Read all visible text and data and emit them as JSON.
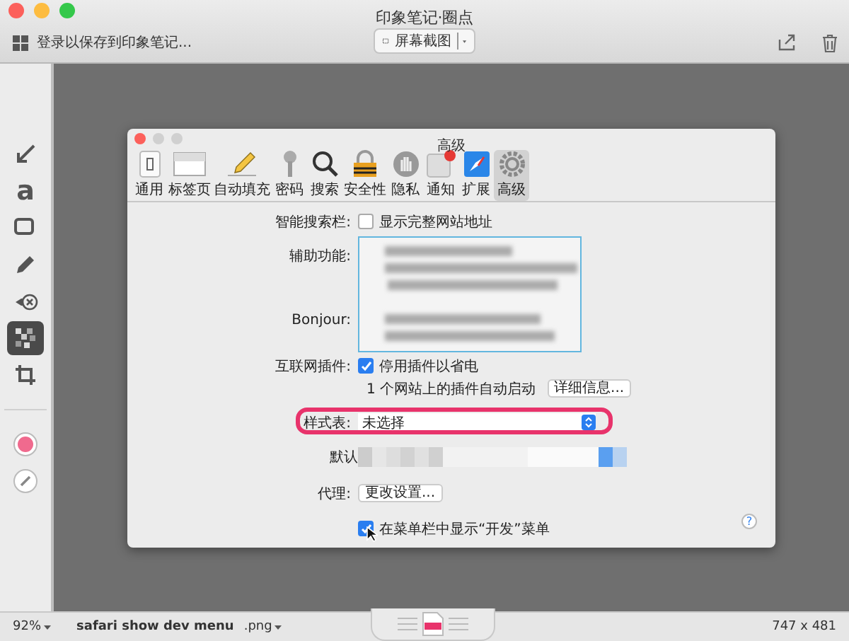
{
  "window": {
    "title": "印象笔记·圈点"
  },
  "toolbar": {
    "login": "登录以保存到印象笔记...",
    "capture_button": "屏幕截图"
  },
  "tools": [
    {
      "kind": "arrow",
      "selected": false
    },
    {
      "kind": "text",
      "label": "a",
      "selected": false
    },
    {
      "kind": "rectangle",
      "selected": false
    },
    {
      "kind": "pen",
      "selected": false
    },
    {
      "kind": "stamp",
      "selected": false
    },
    {
      "kind": "pixelate",
      "selected": true
    },
    {
      "kind": "crop",
      "selected": false
    }
  ],
  "color_swatch": {
    "color": "#f06a8e"
  },
  "canvas": {
    "prefs_window": {
      "title": "高级",
      "tabs": [
        {
          "kind": "general",
          "label": "通用",
          "selected": false
        },
        {
          "kind": "tabs",
          "label": "标签页",
          "selected": false
        },
        {
          "kind": "autofill",
          "label": "自动填充",
          "selected": false
        },
        {
          "kind": "passwords",
          "label": "密码",
          "selected": false
        },
        {
          "kind": "search",
          "label": "搜索",
          "selected": false
        },
        {
          "kind": "security",
          "label": "安全性",
          "selected": false
        },
        {
          "kind": "privacy",
          "label": "隐私",
          "selected": false
        },
        {
          "kind": "notifications",
          "label": "通知",
          "selected": false
        },
        {
          "kind": "extensions",
          "label": "扩展",
          "selected": false
        },
        {
          "kind": "advanced",
          "label": "高级",
          "selected": true
        }
      ],
      "smart_search": {
        "label": "智能搜索栏:",
        "checkbox": "显示完整网站地址",
        "checked": false
      },
      "accessibility": {
        "label": "辅助功能:",
        "bonjour_label": "Bonjour:"
      },
      "plugins": {
        "label": "互联网插件:",
        "checkbox": "停用插件以省电",
        "checked": true,
        "note": "1 个网站上的插件自动启动",
        "button": "详细信息..."
      },
      "stylesheet": {
        "label": "样式表:",
        "value": "未选择",
        "highlighted": true
      },
      "default_label": "默认",
      "proxy": {
        "label": "代理:",
        "button": "更改设置..."
      },
      "develop_menu": {
        "checkbox": "在菜单栏中显示“开发”菜单",
        "checked": true
      },
      "help": "?"
    }
  },
  "status_bar": {
    "zoom": "92%",
    "filename": "safari show dev menu",
    "format": ".png",
    "dimensions": "747 x 481"
  }
}
